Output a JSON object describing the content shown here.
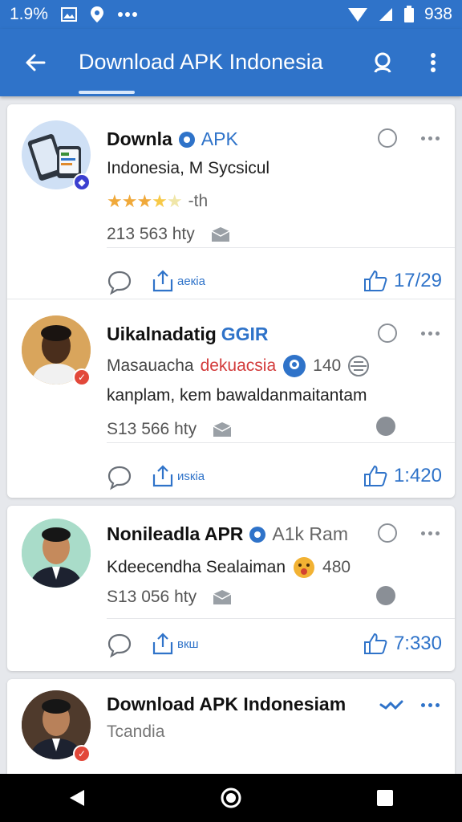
{
  "status": {
    "left_text": "1.9%",
    "battery": "938",
    "icons": [
      "gallery-icon",
      "location-icon",
      "more-dots-icon",
      "wifi-icon",
      "signal-icon",
      "battery-icon"
    ]
  },
  "appbar": {
    "title": "Download APK Indonesia",
    "accent": "#2f73c9"
  },
  "posts": [
    {
      "name": "Downla",
      "tag": "APK",
      "line1": "Indonesia, M Sycsicul",
      "rating_suffix": "-th",
      "meta": "213 563 hty",
      "share_label": "aeкia",
      "likes": "17/29"
    },
    {
      "name": "Uikalnadatig",
      "tag": "GGIR",
      "line1_prefix": "Masauacha",
      "line1_red": "dekuacsia",
      "line1_count": "140",
      "line2": "kanplam, kem bawaldanmaitantam",
      "meta": "S13 566 hty",
      "share_label": "иsкia",
      "likes": "1:420"
    },
    {
      "name": "Nonileadla APR",
      "tag": "A1k Ram",
      "line1_prefix": "Kdeecendha Sealaiman",
      "line1_count": "480",
      "meta": "S13 056 hty",
      "share_label": "вкш",
      "likes": "7:330"
    },
    {
      "name": "Download APK Indonesiam",
      "line1": "Tcandia"
    }
  ],
  "navbar": {
    "icons": [
      "back-triangle-icon",
      "home-circle-icon",
      "recents-square-icon"
    ]
  }
}
